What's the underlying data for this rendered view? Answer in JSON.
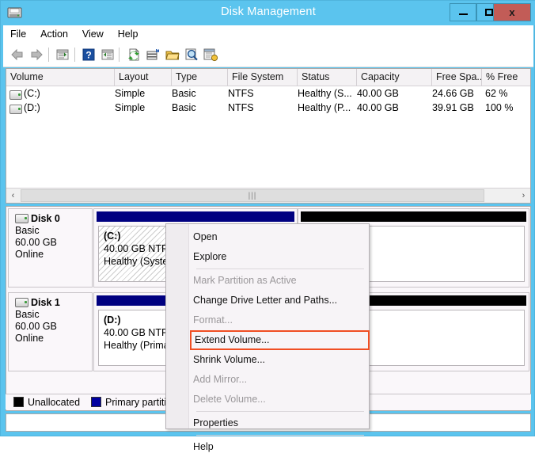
{
  "window": {
    "title": "Disk Management",
    "icon": "disk-management-icon",
    "controls": {
      "minimize": "minimize-icon",
      "maximize": "maximize-icon",
      "close": "x"
    },
    "colors": {
      "titlebar": "#5bc4ee",
      "close_button": "#c25c57",
      "primary_partition": "#000080",
      "unallocated": "#000000",
      "highlight_box": "#f04e23"
    }
  },
  "menubar": {
    "items": [
      {
        "label": "File"
      },
      {
        "label": "Action"
      },
      {
        "label": "View"
      },
      {
        "label": "Help"
      }
    ]
  },
  "toolbar": {
    "icons": [
      {
        "name": "back-arrow-icon"
      },
      {
        "name": "forward-arrow-icon"
      },
      {
        "name": "show-hide-console-tree-icon"
      },
      {
        "name": "help-icon"
      },
      {
        "name": "show-action-pane-icon"
      },
      {
        "name": "refresh-icon"
      },
      {
        "name": "rescan-disks-icon"
      },
      {
        "name": "open-folder-icon"
      },
      {
        "name": "properties-icon"
      },
      {
        "name": "help-topics-icon"
      }
    ]
  },
  "volume_list": {
    "columns": [
      {
        "label": "Volume"
      },
      {
        "label": "Layout"
      },
      {
        "label": "Type"
      },
      {
        "label": "File System"
      },
      {
        "label": "Status"
      },
      {
        "label": "Capacity"
      },
      {
        "label": "Free Spa..."
      },
      {
        "label": "% Free"
      }
    ],
    "rows": [
      {
        "volume": "(C:)",
        "layout": "Simple",
        "type": "Basic",
        "file_system": "NTFS",
        "status": "Healthy (S...",
        "capacity": "40.00 GB",
        "free_space": "24.66 GB",
        "percent_free": "62 %"
      },
      {
        "volume": "(D:)",
        "layout": "Simple",
        "type": "Basic",
        "file_system": "NTFS",
        "status": "Healthy (P...",
        "capacity": "40.00 GB",
        "free_space": "39.91 GB",
        "percent_free": "100 %"
      }
    ],
    "scrollbar": {
      "left_arrow": "‹",
      "right_arrow": "›",
      "grip": "|||"
    }
  },
  "graphical_view": {
    "disks": [
      {
        "name": "Disk 0",
        "type": "Basic",
        "size": "60.00 GB",
        "status": "Online",
        "partitions": [
          {
            "label": "(C:)",
            "size_fs": "40.00 GB NTFS",
            "status": "Healthy (System",
            "bar_color": "#000080",
            "fill": "hatched"
          },
          {
            "label": "",
            "size_fs": "",
            "status": "",
            "bar_color": "#000000",
            "fill": "plain"
          }
        ]
      },
      {
        "name": "Disk 1",
        "type": "Basic",
        "size": "60.00 GB",
        "status": "Online",
        "partitions": [
          {
            "label": "(D:)",
            "size_fs": "40.00 GB NTFS",
            "status": "Healthy (Primar",
            "bar_color": "#000080",
            "fill": "plain"
          },
          {
            "label": "",
            "size_fs": "",
            "status": "",
            "bar_color": "#000000",
            "fill": "plain"
          }
        ]
      }
    ]
  },
  "legend": {
    "items": [
      {
        "label": "Unallocated",
        "color": "#000000"
      },
      {
        "label": "Primary partition",
        "color": "#0000a0"
      }
    ]
  },
  "context_menu": {
    "items": [
      {
        "label": "Open",
        "state": "enabled",
        "kind": "item"
      },
      {
        "label": "Explore",
        "state": "enabled",
        "kind": "item"
      },
      {
        "label": "",
        "state": "",
        "kind": "separator"
      },
      {
        "label": "Mark Partition as Active",
        "state": "disabled",
        "kind": "item"
      },
      {
        "label": "Change Drive Letter and Paths...",
        "state": "enabled",
        "kind": "item"
      },
      {
        "label": "Format...",
        "state": "disabled",
        "kind": "item"
      },
      {
        "label": "Extend Volume...",
        "state": "enabled",
        "kind": "item",
        "highlighted": true
      },
      {
        "label": "Shrink Volume...",
        "state": "enabled",
        "kind": "item"
      },
      {
        "label": "Add Mirror...",
        "state": "disabled",
        "kind": "item"
      },
      {
        "label": "Delete Volume...",
        "state": "disabled",
        "kind": "item"
      },
      {
        "label": "",
        "state": "",
        "kind": "separator"
      },
      {
        "label": "Properties",
        "state": "enabled",
        "kind": "item"
      },
      {
        "label": "",
        "state": "",
        "kind": "separator"
      },
      {
        "label": "Help",
        "state": "enabled",
        "kind": "item"
      }
    ]
  },
  "statusbar": {
    "text": ""
  }
}
